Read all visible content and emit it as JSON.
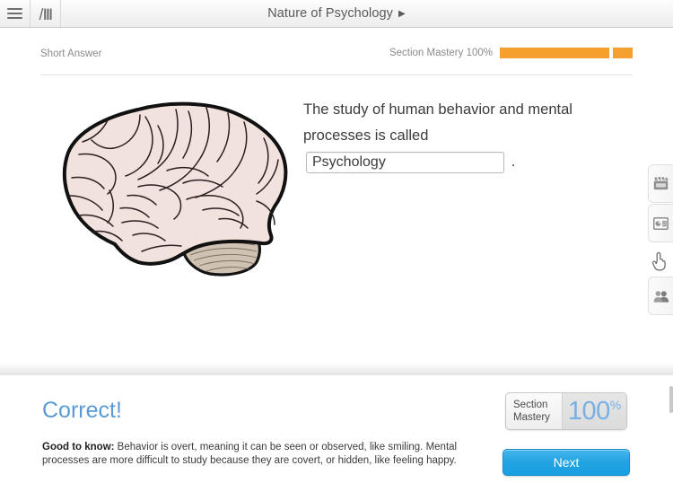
{
  "topbar": {
    "menu_icon": "hamburger-menu-icon",
    "library_icon": "books-shelf-icon",
    "title": "Nature of Psychology",
    "title_caret": "▶"
  },
  "question_header": {
    "question_type": "Short Answer",
    "mastery_label": "Section Mastery 100%",
    "mastery_percent": 100,
    "mastery_color": "#f5a02e"
  },
  "question": {
    "stem_before": "The study of human behavior and mental processes is called",
    "answer_value": "Psychology",
    "answer_placeholder": "",
    "stem_after": ".",
    "image_alt": "human-brain-lateral-view"
  },
  "right_tabs": [
    {
      "name": "video-tab",
      "icon": "film-clapper-icon"
    },
    {
      "name": "presentation-tab",
      "icon": "slide-presentation-icon"
    },
    {
      "name": "people-tab",
      "icon": "people-icon"
    }
  ],
  "cursor": {
    "icon": "hand-pointer-icon"
  },
  "feedback": {
    "title": "Correct!",
    "title_color": "#5b9bd5",
    "body_label": "Good to know:",
    "body_text": " Behavior is overt, meaning it can be seen or observed, like smiling. Mental processes are more difficult to study because they are covert, or hidden, like feeling happy.",
    "mastery_box": {
      "line1": "Section",
      "line2": "Mastery",
      "number": "100",
      "unit": "%",
      "number_color": "#79b0e3"
    },
    "next_label": "Next",
    "next_color": "#22a3e2"
  }
}
